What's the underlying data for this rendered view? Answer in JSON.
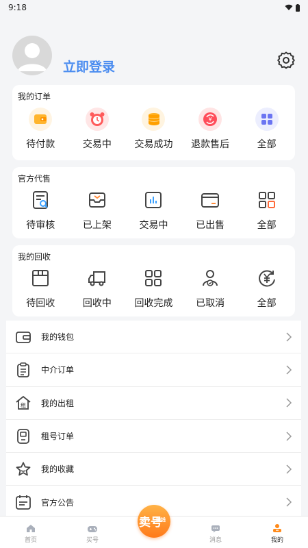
{
  "status": {
    "time": "9:18"
  },
  "profile": {
    "login_label": "立即登录"
  },
  "orders": {
    "title": "我的订单",
    "items": [
      {
        "label": "待付款",
        "icon": "wallet-icon"
      },
      {
        "label": "交易中",
        "icon": "alarm-clock-icon"
      },
      {
        "label": "交易成功",
        "icon": "coins-icon"
      },
      {
        "label": "退款售后",
        "icon": "refund-icon"
      },
      {
        "label": "全部",
        "icon": "grid-icon"
      }
    ]
  },
  "official": {
    "title": "官方代售",
    "items": [
      {
        "label": "待审核",
        "icon": "review-icon"
      },
      {
        "label": "已上架",
        "icon": "inbox-icon"
      },
      {
        "label": "交易中",
        "icon": "chart-icon"
      },
      {
        "label": "已出售",
        "icon": "card-icon"
      },
      {
        "label": "全部",
        "icon": "grid-icon"
      }
    ]
  },
  "recycle": {
    "title": "我的回收",
    "items": [
      {
        "label": "待回收",
        "icon": "box-icon"
      },
      {
        "label": "回收中",
        "icon": "truck-icon"
      },
      {
        "label": "回收完成",
        "icon": "grid-icon"
      },
      {
        "label": "已取消",
        "icon": "user-check-icon"
      },
      {
        "label": "全部",
        "icon": "yen-icon"
      }
    ]
  },
  "menu": [
    {
      "label": "我的钱包",
      "icon": "wallet-outline-icon"
    },
    {
      "label": "中介订单",
      "icon": "clipboard-icon"
    },
    {
      "label": "我的出租",
      "icon": "rent-house-icon"
    },
    {
      "label": "租号订单",
      "icon": "device-icon"
    },
    {
      "label": "我的收藏",
      "icon": "star-icon"
    },
    {
      "label": "官方公告",
      "icon": "calendar-icon"
    }
  ],
  "tabbar": {
    "items": [
      {
        "label": "首页",
        "icon": "home-icon"
      },
      {
        "label": "买号",
        "icon": "gamepad-icon"
      },
      {
        "label": "",
        "icon": "sell-icon"
      },
      {
        "label": "消息",
        "icon": "message-icon"
      },
      {
        "label": "我的",
        "icon": "profile-icon"
      }
    ],
    "center_label": "卖号",
    "center_badge": "赚钱"
  },
  "colors": {
    "accent": "#4a8cf0",
    "orange": "#ff7a1a",
    "icon_gray": "#444444"
  }
}
